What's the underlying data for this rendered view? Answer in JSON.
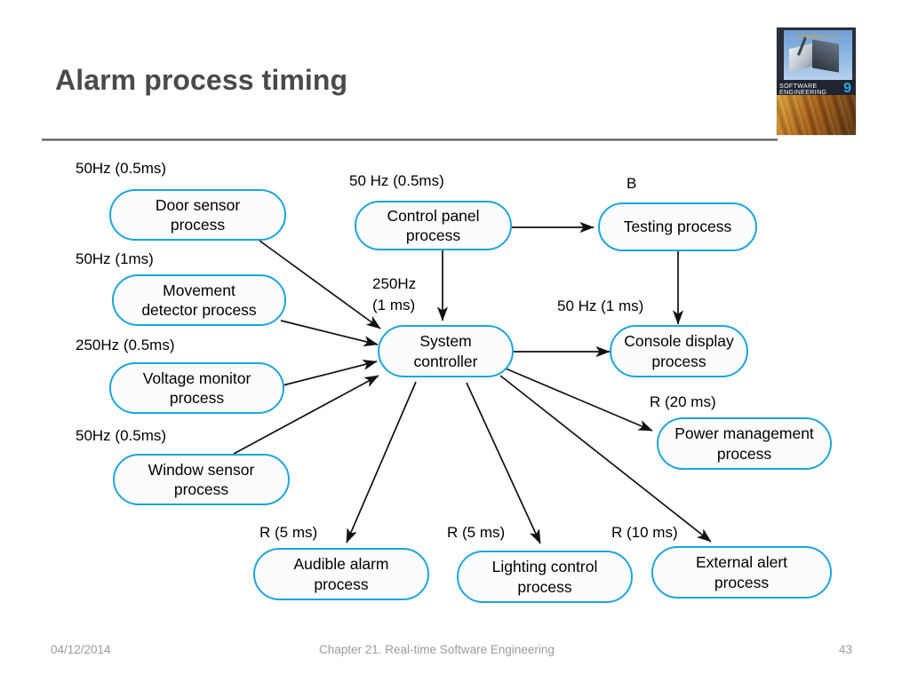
{
  "slide": {
    "title": "Alarm process timing",
    "book_cover": {
      "author": "SOMMERVILLE",
      "series_title": "SOFTWARE ENGINEERING",
      "edition": "9"
    }
  },
  "diagram": {
    "nodes": [
      {
        "id": "door-sensor",
        "lines": [
          "Door sensor",
          "process"
        ]
      },
      {
        "id": "movement-detector",
        "lines": [
          "Movement",
          "detector process"
        ]
      },
      {
        "id": "voltage-monitor",
        "lines": [
          "Voltage monitor",
          "process"
        ]
      },
      {
        "id": "window-sensor",
        "lines": [
          "Window sensor",
          "process"
        ]
      },
      {
        "id": "control-panel",
        "lines": [
          "Control panel",
          "process"
        ]
      },
      {
        "id": "system-controller",
        "lines": [
          "System",
          "controller"
        ]
      },
      {
        "id": "testing",
        "lines": [
          "Testing process"
        ]
      },
      {
        "id": "console-display",
        "lines": [
          "Console display",
          "process"
        ]
      },
      {
        "id": "power-management",
        "lines": [
          "Power management",
          "process"
        ]
      },
      {
        "id": "audible-alarm",
        "lines": [
          "Audible alarm",
          "process"
        ]
      },
      {
        "id": "lighting-control",
        "lines": [
          "Lighting control",
          "process"
        ]
      },
      {
        "id": "external-alert",
        "lines": [
          "External alert",
          "process"
        ]
      }
    ],
    "annotations": [
      {
        "id": "door-sensor-timing",
        "text": "50Hz (0.5ms)"
      },
      {
        "id": "movement-detector-timing",
        "text": "50Hz (1ms)"
      },
      {
        "id": "voltage-monitor-timing",
        "text": "250Hz (0.5ms)"
      },
      {
        "id": "window-sensor-timing",
        "text": "50Hz (0.5ms)"
      },
      {
        "id": "control-panel-timing",
        "text": "50 Hz (0.5ms)"
      },
      {
        "id": "system-controller-timing-line1",
        "text": "250Hz"
      },
      {
        "id": "system-controller-timing-line2",
        "text": "(1 ms)"
      },
      {
        "id": "testing-label",
        "text": "B"
      },
      {
        "id": "console-display-timing",
        "text": "50 Hz (1 ms)"
      },
      {
        "id": "power-management-timing",
        "text": "R (20 ms)"
      },
      {
        "id": "audible-alarm-timing",
        "text": "R (5 ms)"
      },
      {
        "id": "lighting-control-timing",
        "text": "R (5 ms)"
      },
      {
        "id": "external-alert-timing",
        "text": "R (10 ms)"
      }
    ]
  },
  "footer": {
    "date": "04/12/2014",
    "chapter": "Chapter 21. Real-time Software Engineering",
    "page": "43"
  }
}
